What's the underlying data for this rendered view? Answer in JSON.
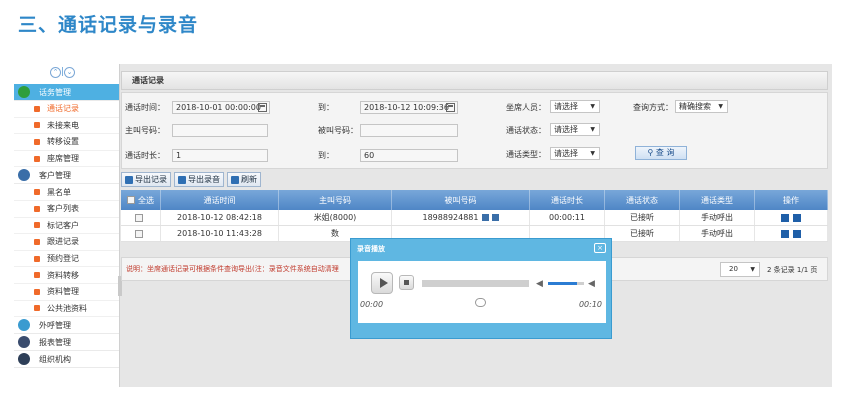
{
  "heading": "三、通话记录与录音",
  "sidebar": {
    "toggle": [
      "⌃",
      "⌄"
    ],
    "groups": [
      {
        "label": "话务管理",
        "color": "#4caf50",
        "active": true,
        "items": [
          "通话记录",
          "未接来电",
          "转移设置",
          "座席管理"
        ],
        "current": 0
      },
      {
        "label": "客户管理",
        "color": "#3a6ea8",
        "active": false,
        "items": [
          "黑名单",
          "客户列表",
          "标记客户",
          "跟进记录",
          "预约登记",
          "资料转移",
          "资料管理",
          "公共池资料"
        ]
      },
      {
        "label": "外呼管理",
        "color": "#3a9bd0",
        "active": false,
        "items": []
      },
      {
        "label": "报表管理",
        "color": "#3a4c6e",
        "active": false,
        "items": []
      },
      {
        "label": "组织机构",
        "color": "#2e3f58",
        "active": false,
        "items": []
      }
    ]
  },
  "panel": {
    "title": "通话记录"
  },
  "search": {
    "call_time_label": "通话时间：",
    "call_time_start": "2018-10-01 00:00:00",
    "to_label_1": "到：",
    "call_time_end": "2018-10-12 10:09:36",
    "agent_label": "坐席人员：",
    "agent_value": "请选择",
    "query_mode_label": "查询方式：",
    "query_mode_value": "精确搜索",
    "caller_label": "主叫号码：",
    "caller_value": "",
    "callee_label": "被叫号码：",
    "callee_value": "",
    "status_label": "通话状态：",
    "status_value": "请选择",
    "duration_label": "通话时长：",
    "duration_from": "1",
    "to_label_2": "到：",
    "duration_to": "60",
    "type_label": "通话类型：",
    "type_value": "请选择",
    "query_button": "查 询"
  },
  "toolbar": {
    "export": "导出记录",
    "export_rec": "导出录音",
    "refresh": "刷新"
  },
  "table": {
    "columns": [
      "全选",
      "通话时间",
      "主叫号码",
      "被叫号码",
      "通话时长",
      "通话状态",
      "通话类型",
      "操作"
    ],
    "rows": [
      {
        "time": "2018-10-12 08:42:18",
        "caller": "米姐(8000)",
        "callee": "18988924881",
        "duration": "00:00:11",
        "status": "已接听",
        "type": "手动呼出"
      },
      {
        "time": "2018-10-10 11:43:28",
        "caller": "数",
        "callee": "",
        "duration": "",
        "status": "已接听",
        "type": "手动呼出"
      }
    ]
  },
  "footer": {
    "note": "说明：坐席通话记录可根据条件查询导出(注：录音文件系统自动清理",
    "page_size": "20",
    "record_count": "2 条记录 1/1 页"
  },
  "modal": {
    "title": "录音播放",
    "close": "×",
    "time_current": "00:00",
    "time_total": "00:10",
    "progress": 0,
    "volume": 0.8
  },
  "colors": {
    "accent": "#4eb0e2",
    "heading": "#2e87c8",
    "header_bar": "#5b8fcc",
    "modal": "#5fb7e2",
    "nav_dot": "#f06a2a"
  }
}
